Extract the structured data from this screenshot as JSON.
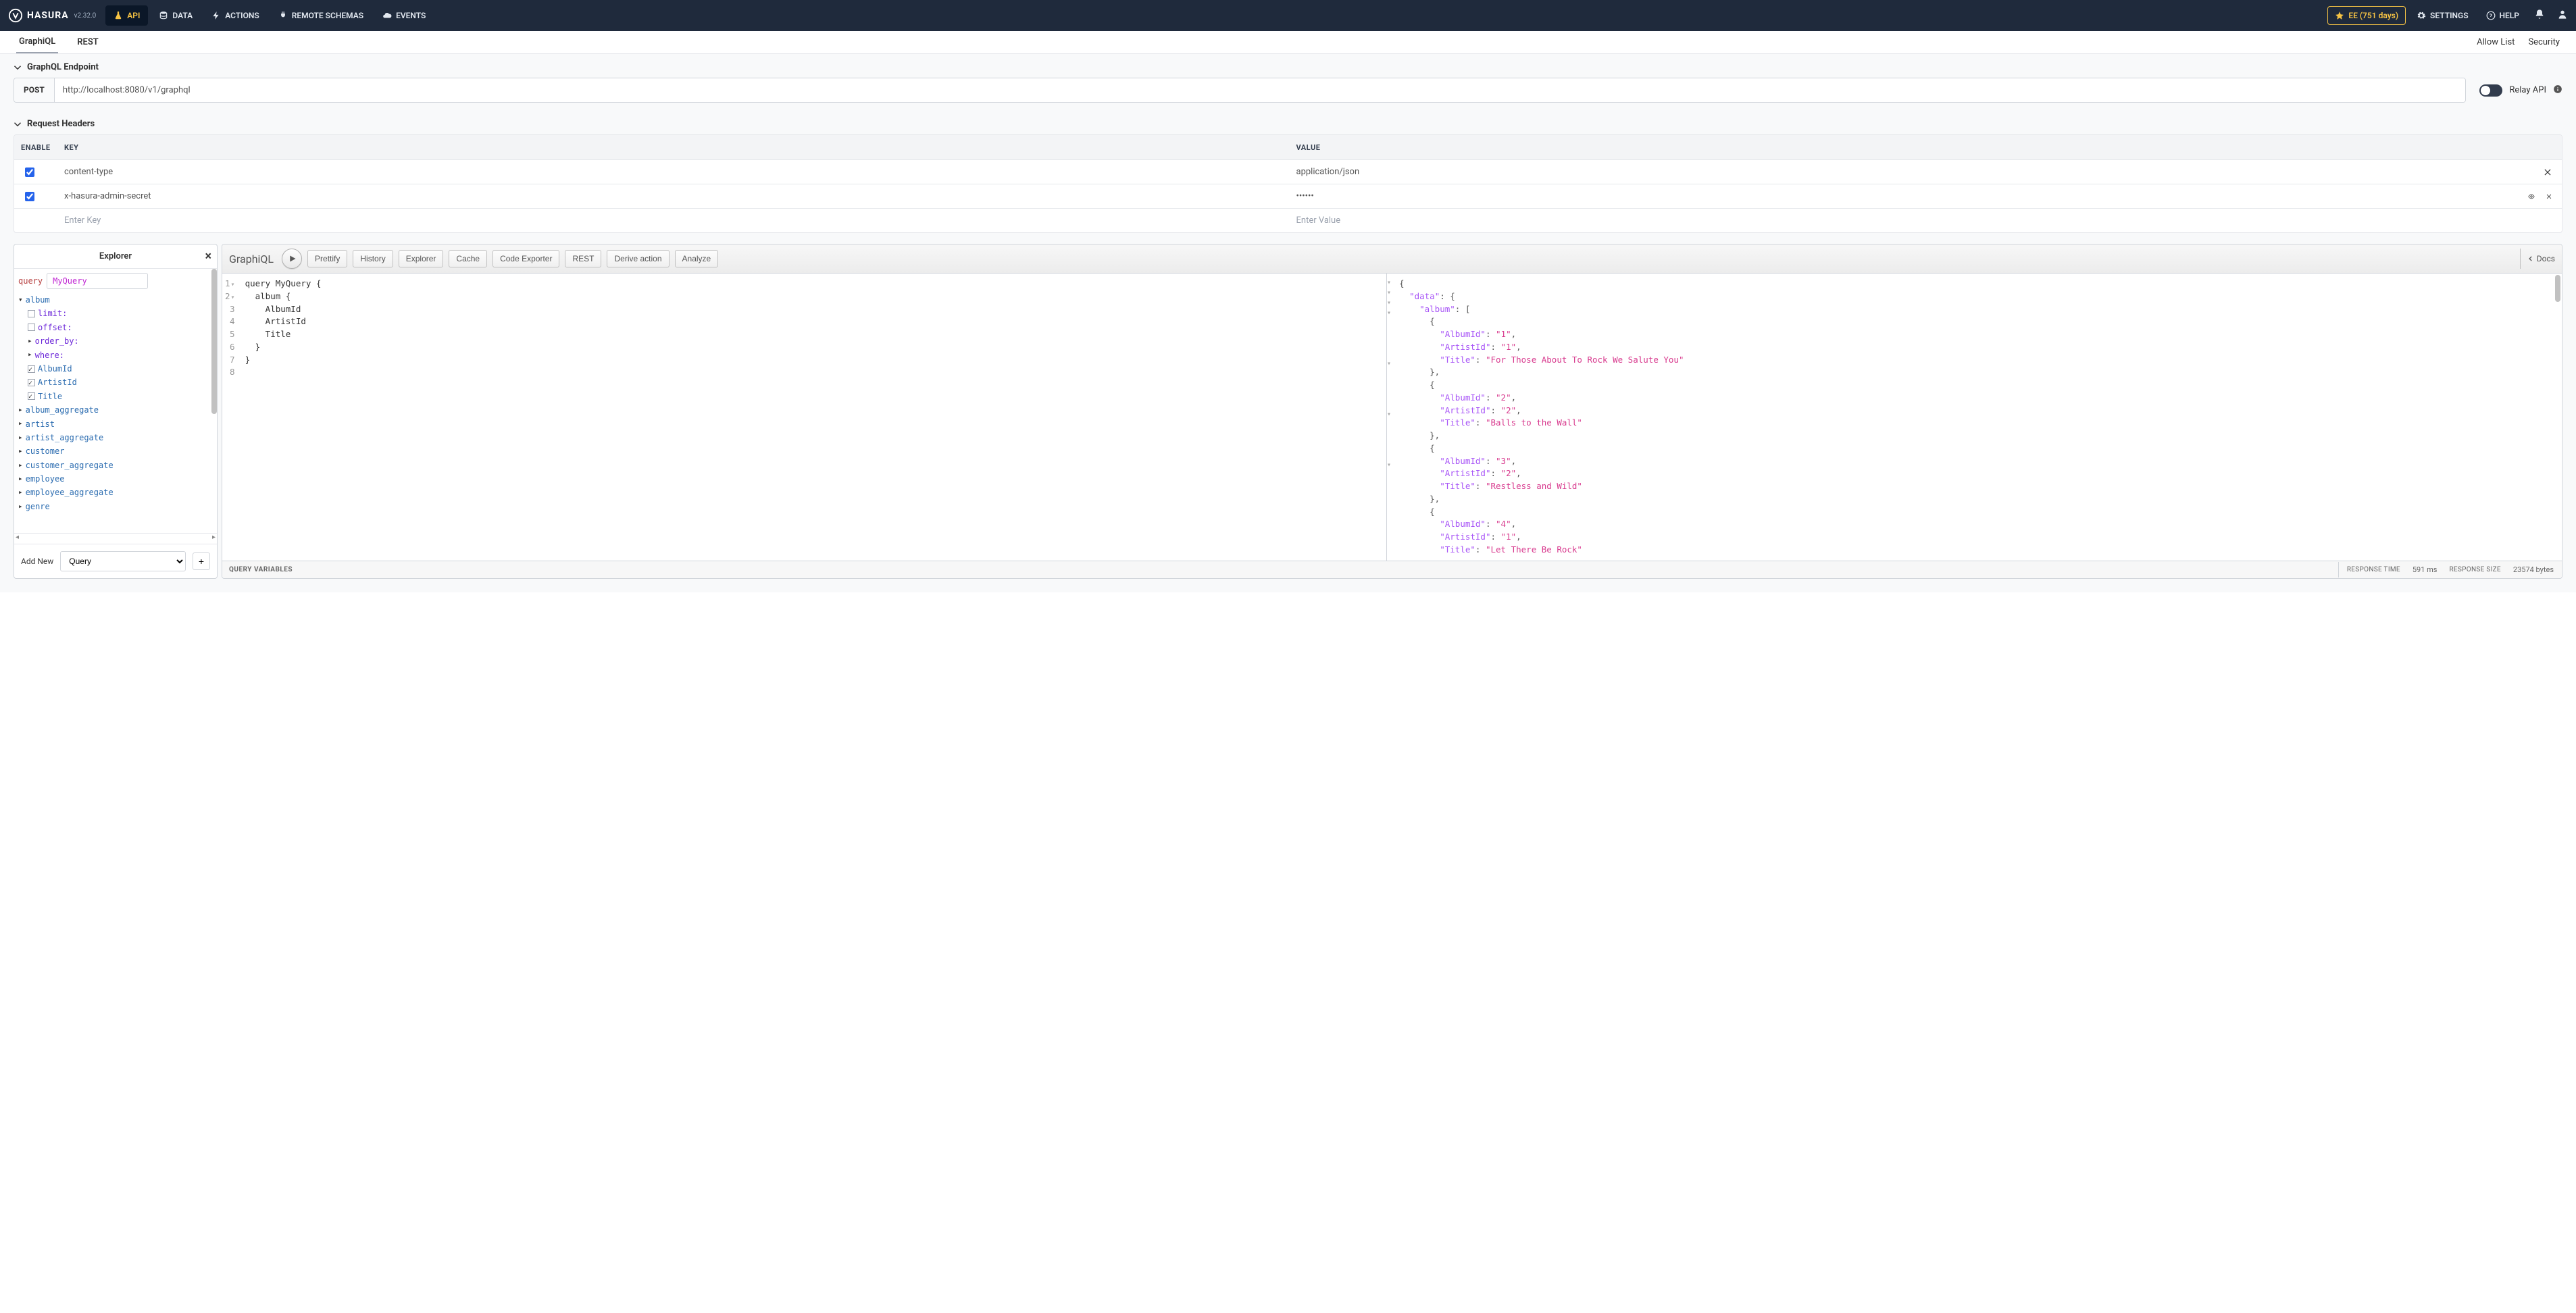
{
  "brand": {
    "name": "HASURA",
    "edition": "EE",
    "version": "v2.32.0"
  },
  "topnav": {
    "items": [
      {
        "label": "API",
        "icon": "flask",
        "active": true
      },
      {
        "label": "DATA",
        "icon": "database"
      },
      {
        "label": "ACTIONS",
        "icon": "bolt"
      },
      {
        "label": "REMOTE SCHEMAS",
        "icon": "plug"
      },
      {
        "label": "EVENTS",
        "icon": "cloud"
      }
    ],
    "ee_badge": "EE (751 days)",
    "settings": "SETTINGS",
    "help": "HELP"
  },
  "subnav": {
    "tabs": [
      {
        "label": "GraphiQL",
        "active": true
      },
      {
        "label": "REST"
      }
    ],
    "right": [
      "Allow List",
      "Security"
    ]
  },
  "endpoint": {
    "section_title": "GraphQL Endpoint",
    "method": "POST",
    "url": "http://localhost:8080/v1/graphql",
    "relay_label": "Relay API"
  },
  "headers": {
    "section_title": "Request Headers",
    "cols": {
      "enable": "ENABLE",
      "key": "KEY",
      "value": "VALUE"
    },
    "rows": [
      {
        "enabled": true,
        "key": "content-type",
        "value": "application/json",
        "has_eye": false,
        "has_remove": true
      },
      {
        "enabled": true,
        "key": "x-hasura-admin-secret",
        "value": "••••••",
        "has_eye": true,
        "has_remove": true
      }
    ],
    "placeholders": {
      "key": "Enter Key",
      "value": "Enter Value"
    }
  },
  "explorer": {
    "title": "Explorer",
    "query_label": "query",
    "query_name": "MyQuery",
    "tree": {
      "root": "album",
      "args": [
        "limit:",
        "offset:",
        "order_by:",
        "where:"
      ],
      "fields": [
        "AlbumId",
        "ArtistId",
        "Title"
      ],
      "siblings": [
        "album_aggregate",
        "artist",
        "artist_aggregate",
        "customer",
        "customer_aggregate",
        "employee",
        "employee_aggregate",
        "genre"
      ]
    },
    "footer": {
      "add_new": "Add New",
      "type_selected": "Query"
    }
  },
  "graphiql": {
    "title": "GraphiQL",
    "buttons": [
      "Prettify",
      "History",
      "Explorer",
      "Cache",
      "Code Exporter",
      "REST",
      "Derive action",
      "Analyze"
    ],
    "docs": "Docs",
    "query_lines": [
      "query MyQuery {",
      "  album {",
      "    AlbumId",
      "    ArtistId",
      "    Title",
      "  }",
      "}",
      ""
    ],
    "result": {
      "data": {
        "album": [
          {
            "AlbumId": "1",
            "ArtistId": "1",
            "Title": "For Those About To Rock We Salute You"
          },
          {
            "AlbumId": "2",
            "ArtistId": "2",
            "Title": "Balls to the Wall"
          },
          {
            "AlbumId": "3",
            "ArtistId": "2",
            "Title": "Restless and Wild"
          },
          {
            "AlbumId": "4",
            "ArtistId": "1",
            "Title": "Let There Be Rock"
          }
        ]
      }
    },
    "footer": {
      "qvars": "QUERY VARIABLES",
      "resp_time_lbl": "RESPONSE TIME",
      "resp_time": "591 ms",
      "resp_size_lbl": "RESPONSE SIZE",
      "resp_size": "23574 bytes"
    }
  }
}
